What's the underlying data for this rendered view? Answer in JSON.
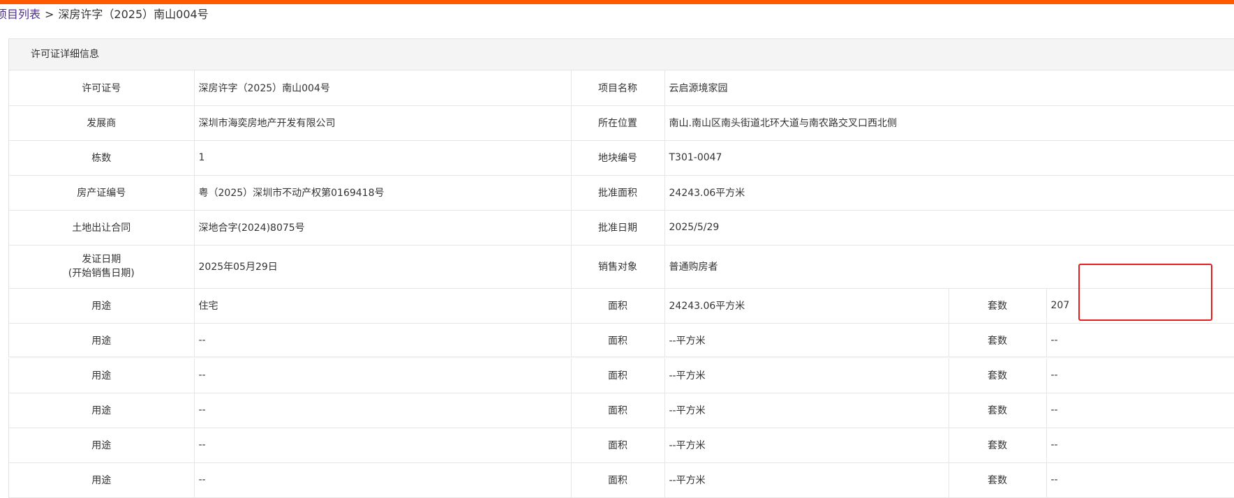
{
  "breadcrumb": {
    "link": "项目列表",
    "separator": ">",
    "current": "深房许字（2025）南山004号"
  },
  "panel_title": "许可证详细信息",
  "fields": {
    "license_no": {
      "label": "许可证号",
      "value": "深房许字（2025）南山004号"
    },
    "project_name": {
      "label": "项目名称",
      "value": "云启源境家园"
    },
    "developer": {
      "label": "发展商",
      "value": "深圳市海奕房地产开发有限公司"
    },
    "location": {
      "label": "所在位置",
      "value": "南山.南山区南头街道北环大道与南农路交叉口西北侧"
    },
    "building_count": {
      "label": "栋数",
      "value": "1"
    },
    "plot_no": {
      "label": "地块编号",
      "value": "T301-0047"
    },
    "property_cert": {
      "label": "房产证编号",
      "value": "粤（2025）深圳市不动产权第0169418号"
    },
    "approved_area": {
      "label": "批准面积",
      "value": "24243.06平方米"
    },
    "land_contract": {
      "label": "土地出让合同",
      "value": "深地合字(2024)8075号"
    },
    "approval_date": {
      "label": "批准日期",
      "value": "2025/5/29"
    },
    "issue_date": {
      "label_line1": "发证日期",
      "label_line2": "(开始销售日期)",
      "value": "2025年05月29日"
    },
    "sales_target": {
      "label": "销售对象",
      "value": "普通购房者"
    }
  },
  "usage_rows": [
    {
      "use_label": "用途",
      "use": "住宅",
      "area_label": "面积",
      "area": "24243.06平方米",
      "units_label": "套数",
      "units": "207"
    },
    {
      "use_label": "用途",
      "use": "--",
      "area_label": "面积",
      "area": "--平方米",
      "units_label": "套数",
      "units": "--"
    },
    {
      "use_label": "用途",
      "use": "--",
      "area_label": "面积",
      "area": "--平方米",
      "units_label": "套数",
      "units": "--"
    },
    {
      "use_label": "用途",
      "use": "--",
      "area_label": "面积",
      "area": "--平方米",
      "units_label": "套数",
      "units": "--"
    },
    {
      "use_label": "用途",
      "use": "--",
      "area_label": "面积",
      "area": "--平方米",
      "units_label": "套数",
      "units": "--"
    },
    {
      "use_label": "用途",
      "use": "--",
      "area_label": "面积",
      "area": "--平方米",
      "units_label": "套数",
      "units": "--"
    }
  ],
  "colors": {
    "accent_bar": "#ff5a00",
    "highlight_box": "#e41e1e",
    "link": "#4b2d8f"
  }
}
